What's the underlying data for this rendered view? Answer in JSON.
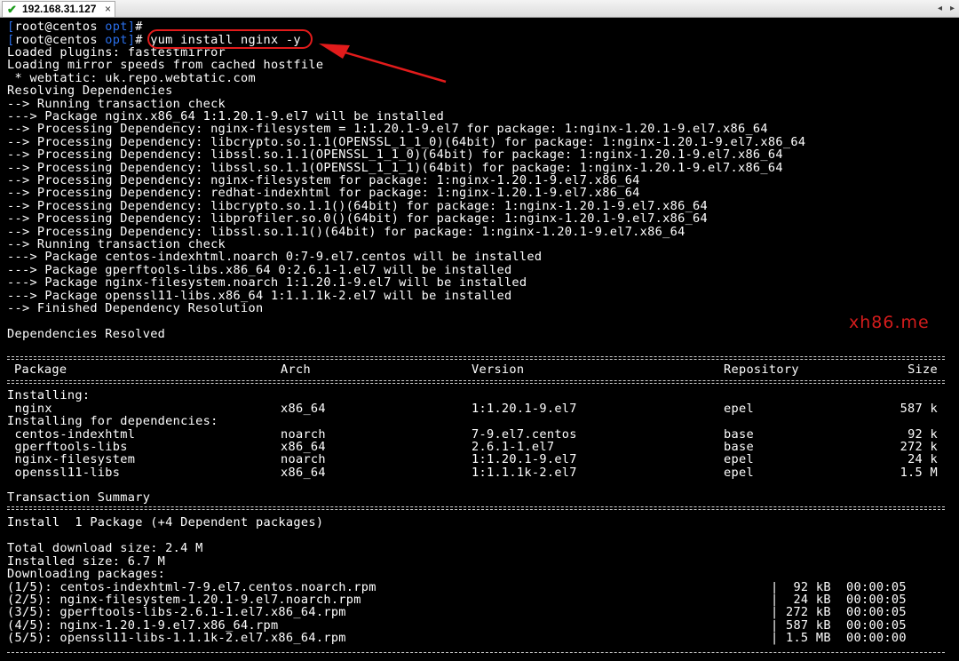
{
  "tab": {
    "title": "192.168.31.127",
    "close": "×"
  },
  "nav": {
    "prev": "◂",
    "next": "▸"
  },
  "prompt": {
    "br_open": "[",
    "user": "root@centos",
    "dir": "opt",
    "br_close": "]",
    "suffix": "# "
  },
  "command": "yum install nginx -y",
  "log1": [
    "Loaded plugins: fastestmirror",
    "Loading mirror speeds from cached hostfile",
    " * webtatic: uk.repo.webtatic.com",
    "Resolving Dependencies",
    "--> Running transaction check",
    "---> Package nginx.x86_64 1:1.20.1-9.el7 will be installed",
    "--> Processing Dependency: nginx-filesystem = 1:1.20.1-9.el7 for package: 1:nginx-1.20.1-9.el7.x86_64",
    "--> Processing Dependency: libcrypto.so.1.1(OPENSSL_1_1_0)(64bit) for package: 1:nginx-1.20.1-9.el7.x86_64",
    "--> Processing Dependency: libssl.so.1.1(OPENSSL_1_1_0)(64bit) for package: 1:nginx-1.20.1-9.el7.x86_64",
    "--> Processing Dependency: libssl.so.1.1(OPENSSL_1_1_1)(64bit) for package: 1:nginx-1.20.1-9.el7.x86_64",
    "--> Processing Dependency: nginx-filesystem for package: 1:nginx-1.20.1-9.el7.x86_64",
    "--> Processing Dependency: redhat-indexhtml for package: 1:nginx-1.20.1-9.el7.x86_64",
    "--> Processing Dependency: libcrypto.so.1.1()(64bit) for package: 1:nginx-1.20.1-9.el7.x86_64",
    "--> Processing Dependency: libprofiler.so.0()(64bit) for package: 1:nginx-1.20.1-9.el7.x86_64",
    "--> Processing Dependency: libssl.so.1.1()(64bit) for package: 1:nginx-1.20.1-9.el7.x86_64",
    "--> Running transaction check",
    "---> Package centos-indexhtml.noarch 0:7-9.el7.centos will be installed",
    "---> Package gperftools-libs.x86_64 0:2.6.1-1.el7 will be installed",
    "---> Package nginx-filesystem.noarch 1:1.20.1-9.el7 will be installed",
    "---> Package openssl11-libs.x86_64 1:1.1.1k-2.el7 will be installed",
    "--> Finished Dependency Resolution",
    "",
    "Dependencies Resolved"
  ],
  "table": {
    "headers": {
      "package": "Package",
      "arch": "Arch",
      "version": "Version",
      "repository": "Repository",
      "size": "Size"
    },
    "installing_label": "Installing:",
    "deps_label": "Installing for dependencies:",
    "installing": [
      {
        "package": " nginx",
        "arch": "x86_64",
        "version": "1:1.20.1-9.el7",
        "repository": "epel",
        "size": "587 k"
      }
    ],
    "deps": [
      {
        "package": " centos-indexhtml",
        "arch": "noarch",
        "version": "7-9.el7.centos",
        "repository": "base",
        "size": "92 k"
      },
      {
        "package": " gperftools-libs",
        "arch": "x86_64",
        "version": "2.6.1-1.el7",
        "repository": "base",
        "size": "272 k"
      },
      {
        "package": " nginx-filesystem",
        "arch": "noarch",
        "version": "1:1.20.1-9.el7",
        "repository": "epel",
        "size": "24 k"
      },
      {
        "package": " openssl11-libs",
        "arch": "x86_64",
        "version": "1:1.1.1k-2.el7",
        "repository": "epel",
        "size": "1.5 M"
      }
    ]
  },
  "summary": {
    "title": "Transaction Summary",
    "install_line": "Install  1 Package (+4 Dependent packages)",
    "total_download": "Total download size: 2.4 M",
    "installed_size": "Installed size: 6.7 M",
    "downloading": "Downloading packages:"
  },
  "downloads": [
    {
      "name": "(1/5): centos-indexhtml-7-9.el7.centos.noarch.rpm",
      "size": "|  92 kB",
      "time": "00:00:05"
    },
    {
      "name": "(2/5): nginx-filesystem-1.20.1-9.el7.noarch.rpm",
      "size": "|  24 kB",
      "time": "00:00:05"
    },
    {
      "name": "(3/5): gperftools-libs-2.6.1-1.el7.x86_64.rpm",
      "size": "| 272 kB",
      "time": "00:00:05"
    },
    {
      "name": "(4/5): nginx-1.20.1-9.el7.x86_64.rpm",
      "size": "| 587 kB",
      "time": "00:00:05"
    },
    {
      "name": "(5/5): openssl11-libs-1.1.1k-2.el7.x86_64.rpm",
      "size": "| 1.5 MB",
      "time": "00:00:00"
    }
  ],
  "watermark": "xh86.me",
  "colors": {
    "prompt_accent": "#2a6ee8",
    "annotation": "#e21b1b",
    "watermark": "#d31c1c",
    "tab_check": "#1a9a1a"
  }
}
